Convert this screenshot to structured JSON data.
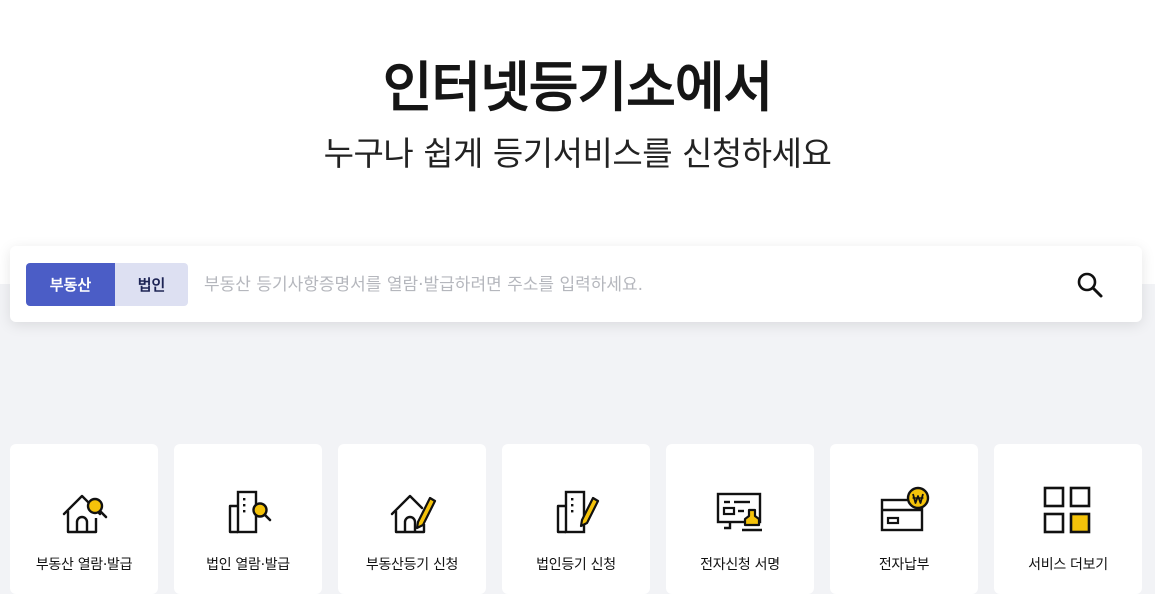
{
  "hero": {
    "title": "인터넷등기소에서",
    "subtitle": "누구나 쉽게 등기서비스를 신청하세요"
  },
  "search": {
    "tabs": [
      {
        "label": "부동산",
        "active": true
      },
      {
        "label": "법인",
        "active": false
      }
    ],
    "placeholder": "부동산 등기사항증명서를 열람·발급하려면 주소를 입력하세요.",
    "value": "",
    "button_icon": "search-icon"
  },
  "services": [
    {
      "label": "부동산 열람·발급",
      "icon": "house-search-icon"
    },
    {
      "label": "법인 열람·발급",
      "icon": "building-search-icon"
    },
    {
      "label": "부동산등기 신청",
      "icon": "house-pen-icon"
    },
    {
      "label": "법인등기 신청",
      "icon": "building-pen-icon"
    },
    {
      "label": "전자신청 서명",
      "icon": "document-stamp-icon"
    },
    {
      "label": "전자납부",
      "icon": "won-card-icon"
    },
    {
      "label": "서비스 더보기",
      "icon": "grid-icon"
    }
  ],
  "colors": {
    "primary": "#4b5dc6",
    "secondary_tab": "#dde0f2",
    "accent_icon": "#f5c30a",
    "background": "#f2f3f6"
  }
}
